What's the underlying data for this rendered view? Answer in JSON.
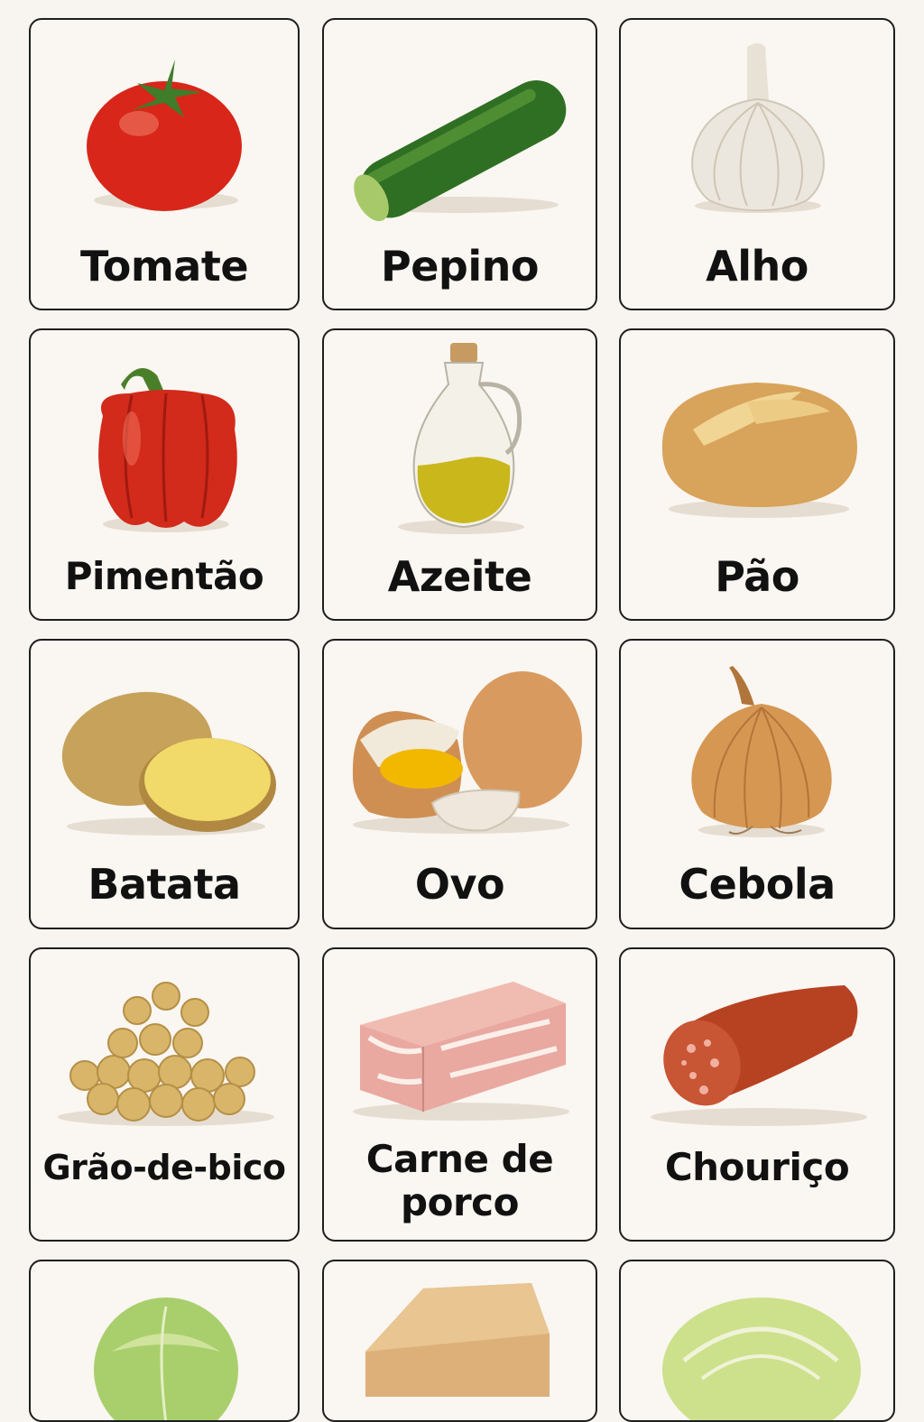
{
  "items": [
    {
      "label": "Tomate",
      "icon": "tomato-icon"
    },
    {
      "label": "Pepino",
      "icon": "cucumber-icon"
    },
    {
      "label": "Alho",
      "icon": "garlic-icon"
    },
    {
      "label": "Pimentão",
      "icon": "bell-pepper-icon"
    },
    {
      "label": "Azeite",
      "icon": "olive-oil-icon"
    },
    {
      "label": "Pão",
      "icon": "bread-icon"
    },
    {
      "label": "Batata",
      "icon": "potato-icon"
    },
    {
      "label": "Ovo",
      "icon": "egg-icon"
    },
    {
      "label": "Cebola",
      "icon": "onion-icon"
    },
    {
      "label": "Grão-de-bico",
      "icon": "chickpeas-icon"
    },
    {
      "label_line1": "Carne de",
      "label_line2": "porco",
      "icon": "pork-meat-icon"
    },
    {
      "label": "Chouriço",
      "icon": "chorizo-icon"
    },
    {
      "label": "",
      "icon": "cabbage-icon"
    },
    {
      "label": "",
      "icon": "cheese-block-icon"
    },
    {
      "label": "",
      "icon": "cabbage-half-icon"
    }
  ],
  "colors": {
    "background": "#f8f4ef",
    "card_border": "#1e1e1e",
    "label_text": "#111111"
  }
}
